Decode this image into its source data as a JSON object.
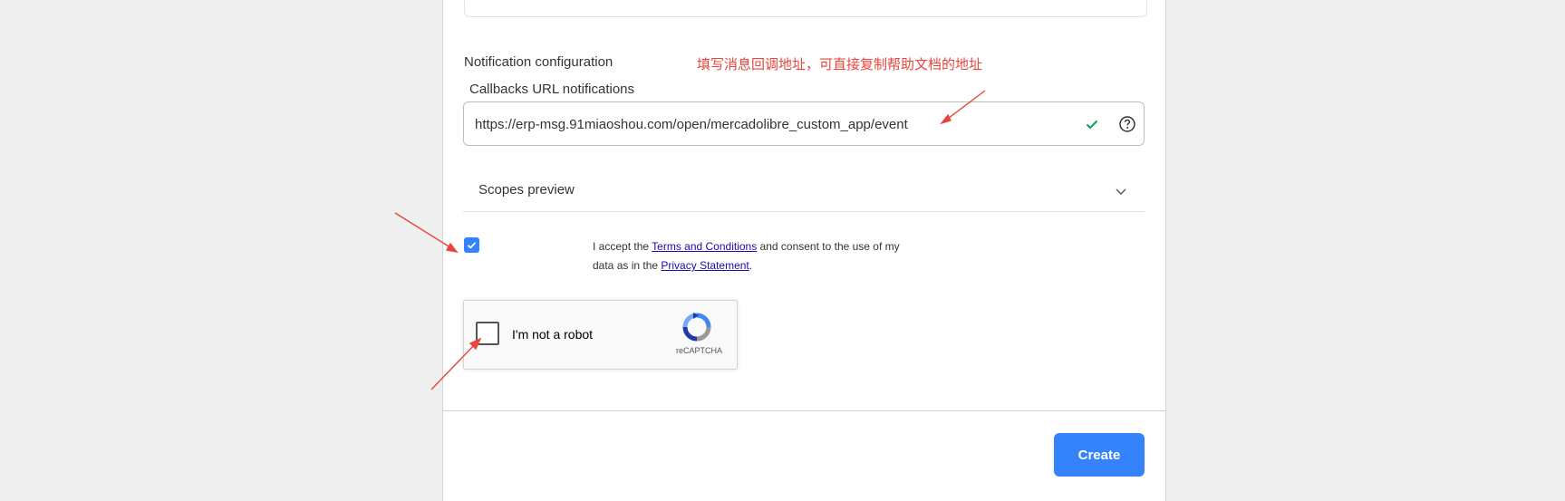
{
  "notification": {
    "section_title": "Notification configuration",
    "annotation": "填写消息回调地址，可直接复制帮助文档的地址",
    "callback_label": "Callbacks URL notifications",
    "callback_url": "https://erp-msg.91miaoshou.com/open/mercadolibre_custom_app/event",
    "valid_icon": "check-icon",
    "help_icon": "question-circle-icon"
  },
  "scopes": {
    "label": "Scopes preview",
    "icon": "chevron-down-icon"
  },
  "terms": {
    "checked": true,
    "prefix": "I accept the ",
    "terms_link": "Terms and Conditions",
    "middle": " and consent to the use of my data as in the ",
    "privacy_link": "Privacy Statement",
    "suffix": "."
  },
  "recaptcha": {
    "label": "I'm not a robot",
    "brand": "reCAPTCHA"
  },
  "footer": {
    "create_label": "Create"
  },
  "colors": {
    "accent": "#3483fa",
    "annotation": "#e8453c",
    "valid": "#00a650"
  }
}
